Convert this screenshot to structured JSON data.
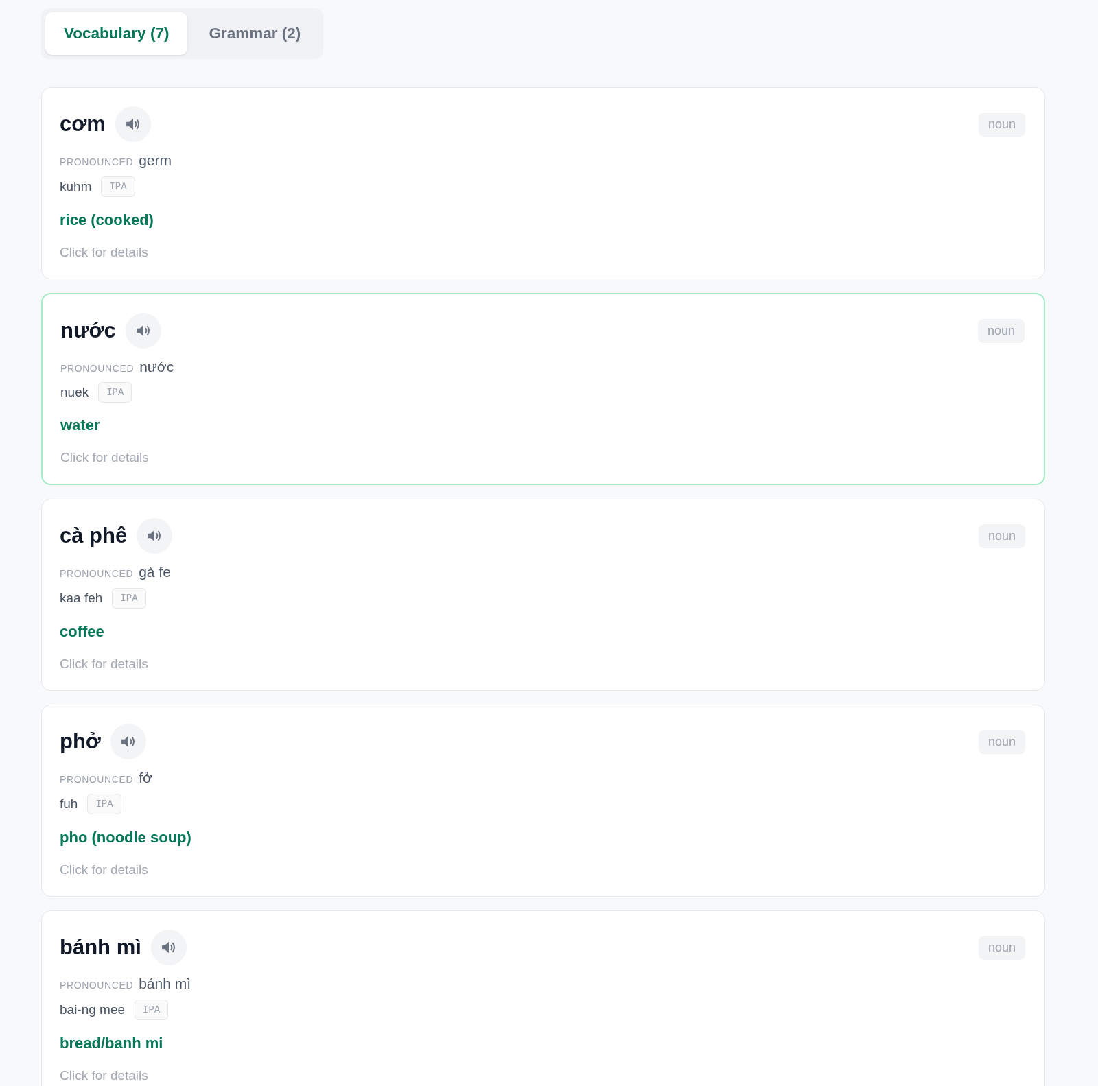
{
  "tabs": [
    {
      "label": "Vocabulary (7)",
      "selected": true
    },
    {
      "label": "Grammar (2)",
      "selected": false
    }
  ],
  "cards": [
    {
      "word": "cơm",
      "part_of_speech": "noun",
      "pronounced_label": "PRONOUNCED",
      "pronounced": "germ",
      "romanization": "kuhm",
      "ipa_label": "IPA",
      "meaning": "rice (cooked)",
      "hint": "Click for details",
      "highlighted": false
    },
    {
      "word": "nước",
      "part_of_speech": "noun",
      "pronounced_label": "PRONOUNCED",
      "pronounced": "nước",
      "romanization": "nuek",
      "ipa_label": "IPA",
      "meaning": "water",
      "hint": "Click for details",
      "highlighted": true
    },
    {
      "word": "cà phê",
      "part_of_speech": "noun",
      "pronounced_label": "PRONOUNCED",
      "pronounced": "gà fe",
      "romanization": "kaa feh",
      "ipa_label": "IPA",
      "meaning": "coffee",
      "hint": "Click for details",
      "highlighted": false
    },
    {
      "word": "phở",
      "part_of_speech": "noun",
      "pronounced_label": "PRONOUNCED",
      "pronounced": "fở",
      "romanization": "fuh",
      "ipa_label": "IPA",
      "meaning": "pho (noodle soup)",
      "hint": "Click for details",
      "highlighted": false
    },
    {
      "word": "bánh mì",
      "part_of_speech": "noun",
      "pronounced_label": "PRONOUNCED",
      "pronounced": "bánh mì",
      "romanization": "bai-ng mee",
      "ipa_label": "IPA",
      "meaning": "bread/banh mi",
      "hint": "Click for details",
      "highlighted": false
    }
  ]
}
